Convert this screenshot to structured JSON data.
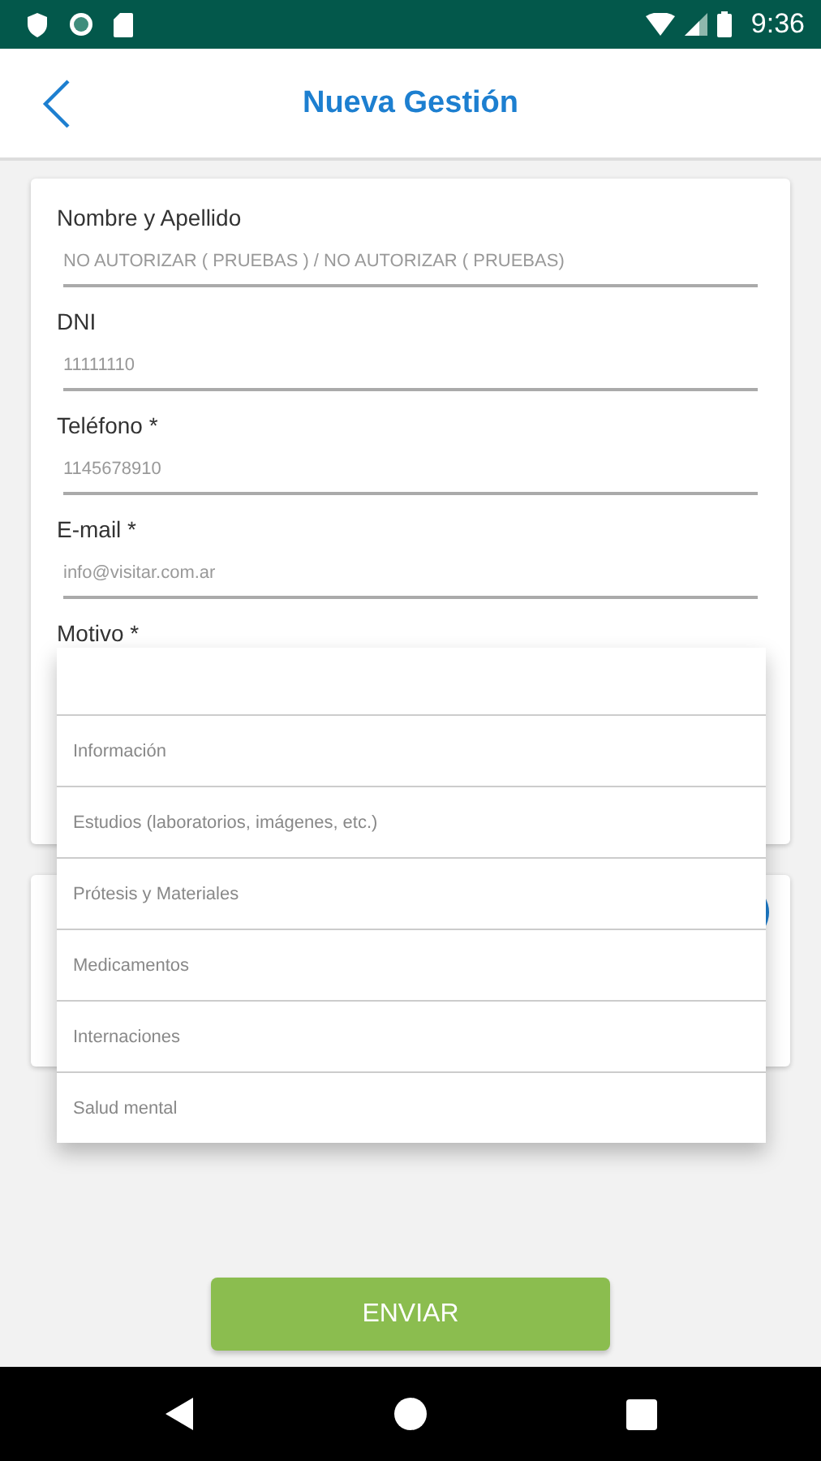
{
  "status_bar": {
    "time": "9:36"
  },
  "header": {
    "title": "Nueva Gestión"
  },
  "form": {
    "fields": [
      {
        "label": "Nombre y Apellido",
        "value": "NO AUTORIZAR ( PRUEBAS ) / NO AUTORIZAR ( PRUEBAS)"
      },
      {
        "label": "DNI",
        "value": "11111110"
      },
      {
        "label": "Teléfono *",
        "value": "1145678910"
      },
      {
        "label": "E-mail *",
        "value": "info@visitar.com.ar"
      }
    ],
    "motivo_label": "Motivo *"
  },
  "motivo_dropdown": {
    "options": [
      {
        "label": "Información"
      },
      {
        "label": "Estudios (laboratorios, imágenes, etc.)"
      },
      {
        "label": "Prótesis y Materiales"
      },
      {
        "label": "Medicamentos"
      },
      {
        "label": "Internaciones"
      },
      {
        "label": "Salud mental"
      }
    ]
  },
  "submit": {
    "label": "ENVIAR"
  }
}
